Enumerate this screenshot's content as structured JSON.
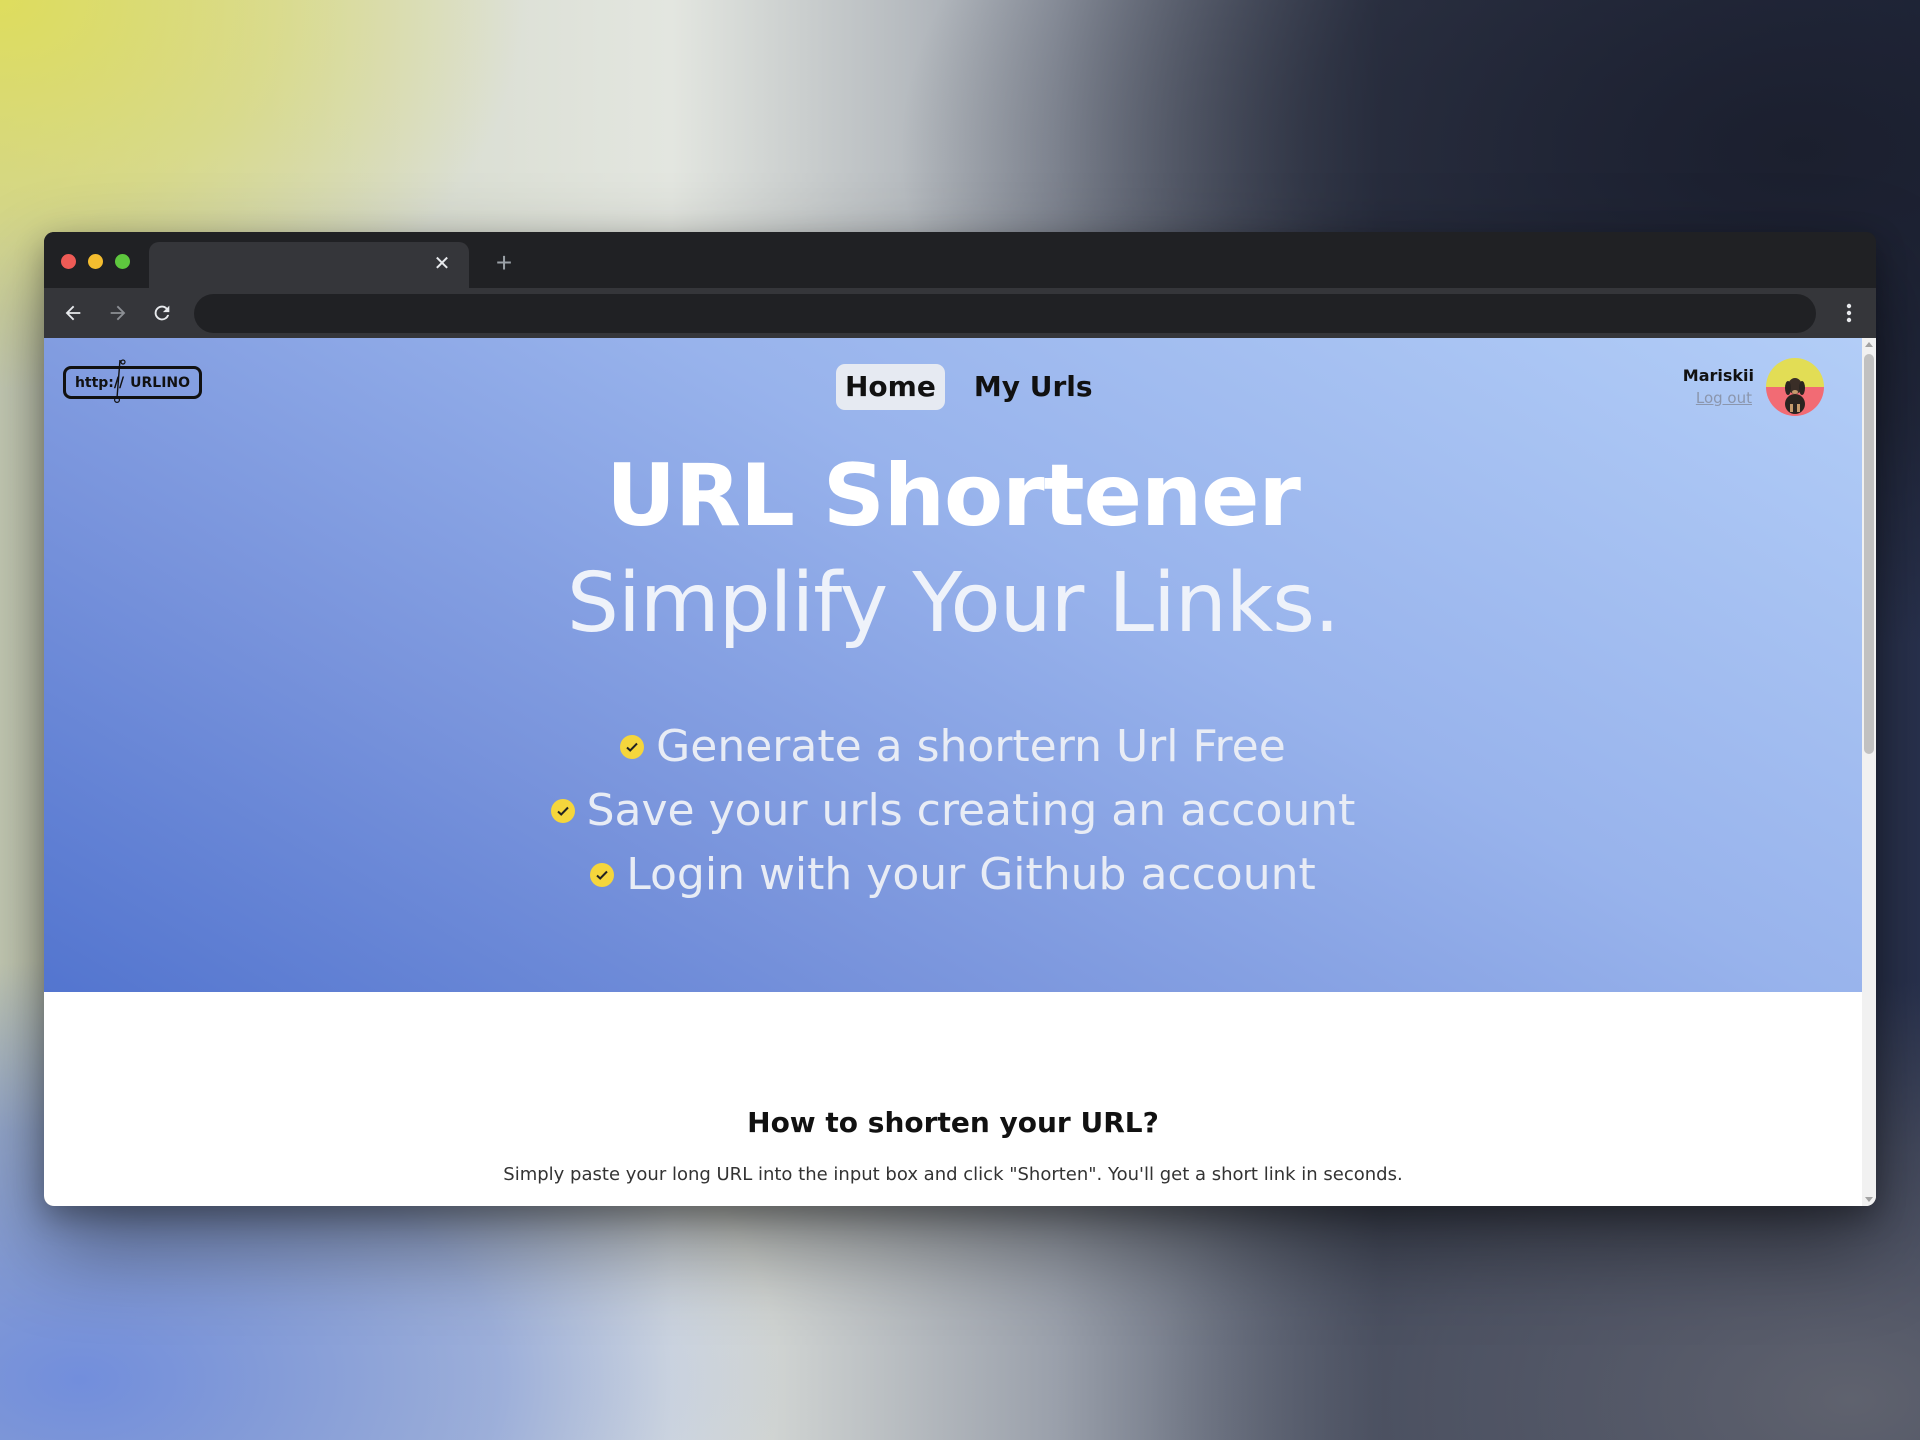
{
  "browser": {
    "tab_close_glyph": "✕",
    "new_tab_glyph": "+",
    "address": ""
  },
  "site": {
    "logo": {
      "left": "http://",
      "right": "URLINO"
    },
    "nav": [
      {
        "label": "Home",
        "active": true
      },
      {
        "label": "My Urls",
        "active": false
      }
    ],
    "user": {
      "name": "Mariskii",
      "logout": "Log out"
    }
  },
  "hero": {
    "title": "URL Shortener",
    "subtitle": "Simplify Your Links.",
    "features": [
      "Generate a shortern Url Free",
      "Save your urls creating an account",
      "Login with your Github account"
    ]
  },
  "how": {
    "title": "How to shorten your URL?",
    "text": "Simply paste your long URL into the input box and click \"Shorten\". You'll get a short link in seconds."
  },
  "colors": {
    "accent_check": "#f5d63c",
    "hero_gradient_start": "#5375cf",
    "hero_gradient_end": "#b2cdf7"
  }
}
